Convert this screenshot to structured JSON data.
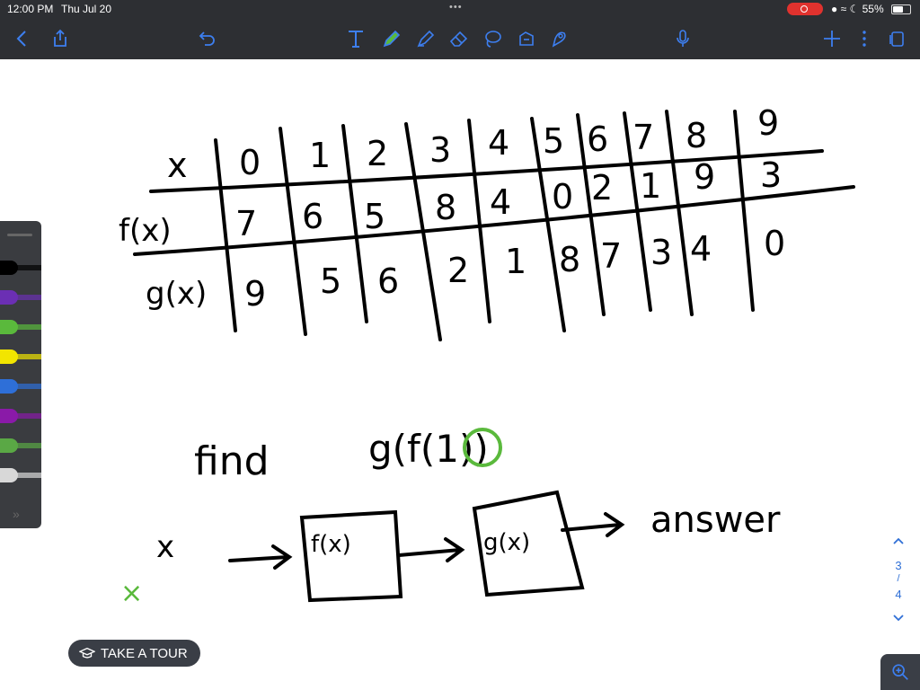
{
  "status": {
    "time": "12:00 PM",
    "date": "Thu Jul 20",
    "battery": "55%",
    "battery_level": 0.55
  },
  "toolbar": {
    "icons": [
      "back-chevron-icon",
      "share-icon",
      "undo-icon",
      "text-tool-icon",
      "pen-tool-icon",
      "highlighter-icon",
      "eraser-icon",
      "lasso-icon",
      "shapes-icon",
      "laser-pointer-icon",
      "microphone-icon",
      "add-icon",
      "more-icon",
      "pages-icon"
    ]
  },
  "palette": {
    "pens": [
      {
        "name": "black-pen",
        "color": "#000000"
      },
      {
        "name": "purple-pen",
        "color": "#6b2fb4"
      },
      {
        "name": "green-pen",
        "color": "#5ab93c"
      },
      {
        "name": "yellow-highlighter",
        "color": "#f2e500"
      },
      {
        "name": "blue-highlighter",
        "color": "#2e6fd8"
      },
      {
        "name": "violet-highlighter",
        "color": "#8a1aa8"
      },
      {
        "name": "green-highlighter",
        "color": "#5aa845"
      },
      {
        "name": "white-highlighter",
        "color": "#d8d8d8"
      }
    ]
  },
  "note": {
    "table": {
      "headers": [
        "x",
        "f(x)",
        "g(x)"
      ],
      "x": [
        "0",
        "1",
        "2",
        "3",
        "4",
        "5",
        "6",
        "7",
        "8",
        "9"
      ],
      "f": [
        "7",
        "6",
        "5",
        "8",
        "4",
        "0",
        "2",
        "1",
        "9",
        "3"
      ],
      "g": [
        "9",
        "5",
        "6",
        "2",
        "1",
        "8",
        "7",
        "3",
        "4",
        "0"
      ]
    },
    "question_prefix": "find",
    "question_expr": "g(f(1))",
    "diagram": {
      "input": "x",
      "box1": "f(x)",
      "box2": "g(x)",
      "output": "answer"
    },
    "green_mark": "×",
    "accent_color": "#5ab93c"
  },
  "pager": {
    "current": "3",
    "separator": "/",
    "total": "4"
  },
  "tour": {
    "label": "TAKE A TOUR"
  }
}
